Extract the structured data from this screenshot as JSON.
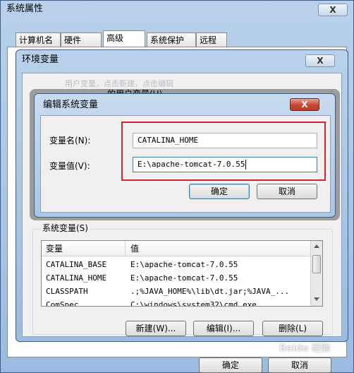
{
  "system_properties": {
    "title": "系统属性",
    "close_label": "X",
    "tabs": [
      "计算机名",
      "硬件",
      "高级",
      "系统保护",
      "远程"
    ],
    "ok_label": "确定",
    "cancel_label": "取消"
  },
  "env_vars": {
    "title": "环境变量",
    "close_label": "X",
    "user_section_label": "的用户变量(U)",
    "user_hint": "用户变量，点击新建，点击编辑",
    "system_section_label": "系统变量(S)",
    "columns": [
      "变量",
      "值"
    ],
    "rows": [
      {
        "name": "CATALINA_BASE",
        "value": "E:\\apache-tomcat-7.0.55"
      },
      {
        "name": "CATALINA_HOME",
        "value": "E:\\apache-tomcat-7.0.55"
      },
      {
        "name": "CLASSPATH",
        "value": ".;%JAVA_HOME%\\lib\\dt.jar;%JAVA_..."
      },
      {
        "name": "ComSpec",
        "value": "C:\\windows\\system32\\cmd.exe"
      }
    ],
    "new_label": "新建(W)...",
    "edit_label": "编辑(I)...",
    "delete_label": "删除(L)"
  },
  "edit_dialog": {
    "title": "编辑系统变量",
    "close_label": "X",
    "name_label": "变量名(N):",
    "name_value": "CATALINA_HOME",
    "value_label": "变量值(V):",
    "value_value": "E:\\apache-tomcat-7.0.55",
    "ok_label": "确定",
    "cancel_label": "取消"
  },
  "highlight_color": "#d3242b",
  "watermark": "Baidu 经验"
}
